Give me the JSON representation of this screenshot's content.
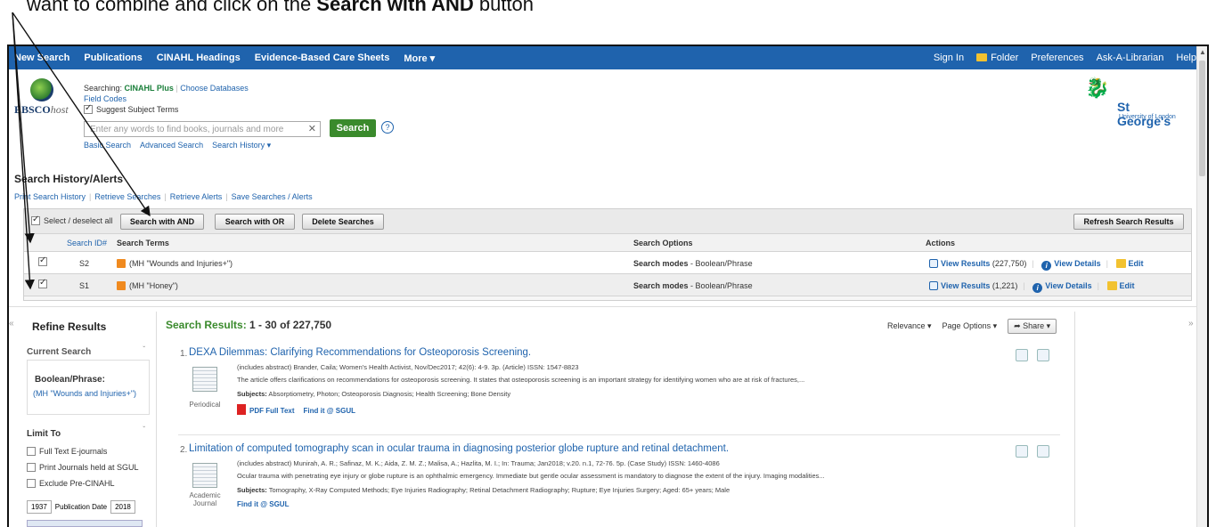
{
  "caption": {
    "plain": "want to combine and click on the ",
    "bold": "Search with AND",
    "tail": " button"
  },
  "topnav": {
    "left": [
      "New Search",
      "Publications",
      "CINAHL Headings",
      "Evidence-Based Care Sheets",
      "More ▾"
    ],
    "right": [
      "Sign In",
      "Folder",
      "Preferences",
      "Ask-A-Librarian",
      "Help"
    ]
  },
  "logo": {
    "brand": "EBSCO",
    "brand_suffix": "host"
  },
  "search": {
    "searching_label": "Searching: ",
    "database": "CINAHL Plus",
    "choose_db": "Choose Databases",
    "field_codes": "Field Codes",
    "suggest_label": "Suggest Subject Terms",
    "placeholder": "Enter any words to find books, journals and more",
    "button": "Search",
    "help": "?",
    "links": [
      "Basic Search",
      "Advanced Search",
      "Search History ▾"
    ]
  },
  "sgul": {
    "name": "St George's",
    "sub": "University of London"
  },
  "history": {
    "title": "Search History/Alerts",
    "links": [
      "Print Search History",
      "Retrieve Searches",
      "Retrieve Alerts",
      "Save Searches / Alerts"
    ],
    "select_all": "Select / deselect all",
    "buttons": [
      "Search with AND",
      "Search with OR",
      "Delete Searches"
    ],
    "refresh": "Refresh Search Results",
    "headers": [
      "Search ID#",
      "Search Terms",
      "Search Options",
      "Actions"
    ],
    "rows": [
      {
        "id": "S2",
        "terms": "(MH \"Wounds and Injuries+\")",
        "options_label": "Search modes",
        "options_value": " - Boolean/Phrase",
        "view": "View Results",
        "count": "(227,750)",
        "details": "View Details",
        "edit": "Edit"
      },
      {
        "id": "S1",
        "terms": "(MH \"Honey\")",
        "options_label": "Search modes",
        "options_value": " - Boolean/Phrase",
        "view": "View Results",
        "count": "(1,221)",
        "details": "View Details",
        "edit": "Edit"
      }
    ]
  },
  "refine": {
    "title": "Refine Results",
    "current": "Current Search",
    "bool_label": "Boolean/Phrase:",
    "bool_value": "(MH \"Wounds and Injuries+\")",
    "limit": "Limit To",
    "limit_items": [
      "Full Text E-journals",
      "Print Journals held at SGUL",
      "Exclude Pre-CINAHL"
    ],
    "pub_from": "1937",
    "pub_label": "Publication Date",
    "pub_to": "2018"
  },
  "results": {
    "label": "Search Results: ",
    "range": "1 - 30 of 227,750",
    "relevance": "Relevance ▾",
    "page_options": "Page Options ▾",
    "share": "Share ▾",
    "items": [
      {
        "num": "1.",
        "title": "DEXA Dilemmas: Clarifying Recommendations for Osteoporosis Screening.",
        "meta": "(includes abstract) Brander, Caila; Women's Health Activist, Nov/Dec2017; 42(6): 4-9. 3p. (Article) ISSN: 1547-8823",
        "abstract": "The article offers clarifications on recommendations for osteoporosis screening. It states that osteoporosis screening is an important strategy for identifying women who are at risk of fractures,...",
        "subjects_label": "Subjects:",
        "subjects": " Absorptiometry, Photon; Osteoporosis Diagnosis; Health Screening; Bone Density",
        "ptype": "Periodical",
        "pdf": "PDF Full Text",
        "findit": "Find it @ SGUL"
      },
      {
        "num": "2.",
        "title": "Limitation of computed tomography scan in ocular trauma in diagnosing posterior globe rupture and retinal detachment.",
        "meta": "(includes abstract) Munirah, A. R.; Safinaz, M. K.; Aida, Z. M. Z.; Malisa, A.; Hazlita, M. I.; In: Trauma; Jan2018; v.20. n.1, 72-76. 5p. (Case Study) ISSN: 1460-4086",
        "abstract": "Ocular trauma with penetrating eye injury or globe rupture is an ophthalmic emergency. Immediate but gentle ocular assessment is mandatory to diagnose the extent of the injury. Imaging modalities...",
        "subjects_label": "Subjects:",
        "subjects": " Tomography, X-Ray Computed Methods; Eye Injuries Radiography; Retinal Detachment Radiography; Rupture; Eye Injuries Surgery; Aged: 65+ years; Male",
        "ptype": "Academic Journal",
        "findit": "Find it @ SGUL"
      }
    ]
  },
  "colors": {
    "nav": "#1f63ad",
    "accent_green": "#3a8a2c",
    "link": "#1f63ad"
  }
}
